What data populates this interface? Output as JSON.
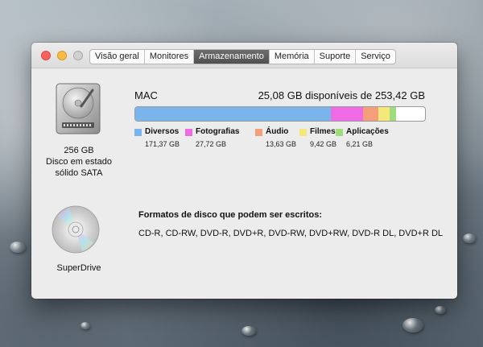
{
  "window": {
    "tabs": [
      {
        "label": "Visão geral",
        "active": false
      },
      {
        "label": "Monitores",
        "active": false
      },
      {
        "label": "Armazenamento",
        "active": true
      },
      {
        "label": "Memória",
        "active": false
      },
      {
        "label": "Suporte",
        "active": false
      },
      {
        "label": "Serviço",
        "active": false
      }
    ]
  },
  "disk": {
    "icon": "hard-drive-icon",
    "capacity": "256 GB",
    "type_line1": "Disco em estado",
    "type_line2": "sólido SATA"
  },
  "volume": {
    "name": "MAC",
    "free_text": "25,08 GB disponíveis de 253,42 GB",
    "free_gb": 25.08,
    "total_gb": 253.42,
    "categories": [
      {
        "name": "Diversos",
        "size": "171,37 GB",
        "gb": 171.37,
        "color": "#7ab4ed"
      },
      {
        "name": "Fotografias",
        "size": "27,72 GB",
        "gb": 27.72,
        "color": "#ef6be6"
      },
      {
        "name": "Áudio",
        "size": "13,63 GB",
        "gb": 13.63,
        "color": "#f3a07a"
      },
      {
        "name": "Filmes",
        "size": "9,42 GB",
        "gb": 9.42,
        "color": "#f5e87a"
      },
      {
        "name": "Aplicações",
        "size": "6,21 GB",
        "gb": 6.21,
        "color": "#9fdc7c"
      }
    ]
  },
  "superdrive": {
    "icon": "optical-disc-icon",
    "name": "SuperDrive",
    "formats_title": "Formatos de disco que podem ser escritos:",
    "formats": "CD-R, CD-RW, DVD-R, DVD+R, DVD-RW, DVD+RW, DVD-R DL, DVD+R DL"
  }
}
